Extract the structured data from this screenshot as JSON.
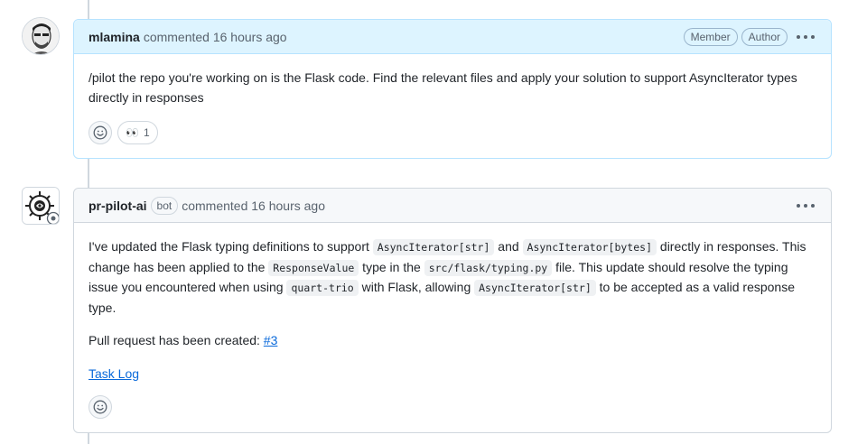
{
  "comments": [
    {
      "author": "mlamina",
      "meta": "commented 16 hours ago",
      "badges": [
        "Member",
        "Author"
      ],
      "body": "/pilot the repo you're working on is the Flask code. Find the relevant files and apply your solution to support AsyncIterator types directly in responses",
      "reactions": [
        {
          "icon": "eyes-emoji",
          "glyph": "👀",
          "count": "1"
        }
      ]
    },
    {
      "author": "pr-pilot-ai",
      "bot_badge": "bot",
      "meta": "commented 16 hours ago",
      "body": {
        "p1_t1": "I've updated the Flask typing definitions to support ",
        "p1_c1": "AsyncIterator[str]",
        "p1_t2": " and ",
        "p1_c2": "AsyncIterator[bytes]",
        "p1_t3": " directly in responses. This change has been applied to the ",
        "p1_c3": "ResponseValue",
        "p1_t4": " type in the ",
        "p1_c4": "src/flask/typing.py",
        "p1_t5": " file. This update should resolve the typing issue you encountered when using ",
        "p1_c5": "quart-trio",
        "p1_t6": " with Flask, allowing ",
        "p1_c6": "AsyncIterator[str]",
        "p1_t7": " to be accepted as a valid response type.",
        "p2_text": "Pull request has been created: ",
        "p2_link": "#3",
        "p3_link": "Task Log"
      }
    }
  ]
}
